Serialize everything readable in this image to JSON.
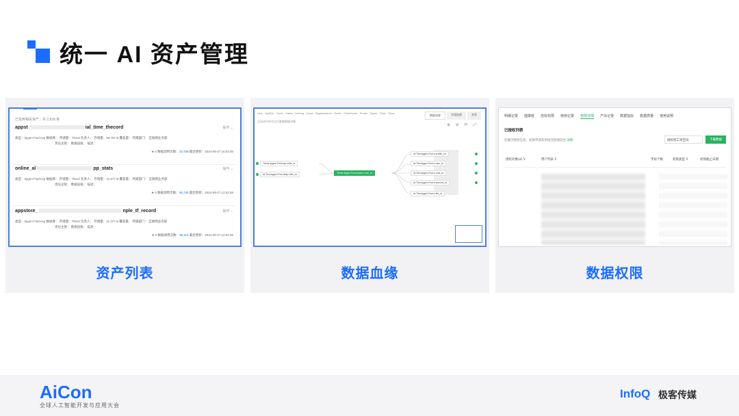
{
  "title": "统一 AI 资产管理",
  "cards": [
    {
      "caption": "资产列表"
    },
    {
      "caption": "数据血缘"
    },
    {
      "caption": "数据权限"
    }
  ],
  "asset_list": {
    "header": "已找到相关资产：共 2,818 条",
    "menu_label": "操作 ⌄",
    "items": [
      {
        "name_prefix": "appst",
        "name_suffix": "ial_time_thecord",
        "meta1": "类型：dygen-Fwd.exp   数据库：          存储量：Tlevel   负责人：             存储量：96.787 B   覆盖量：         所属部门：  互联网业务部",
        "meta2": "责任主管：       数据层级：       描述：",
        "right": "★ 0   数据调用次数：",
        "right_hl": "33,789",
        "right_tail": "   最近更新：2024-09-27 16:03:00"
      },
      {
        "name_prefix": "online_al",
        "name_suffix": "pp_stats",
        "meta1": "类型：dygen-Fwd.exp   数据库：          存储量：Tlevel   负责人：             存储量：21.077 B   覆盖量：         所属部门：  互联网业务部",
        "meta2": "责任主管：       数据层级：       描述：",
        "right": "★ 0   数据调用次数：",
        "right_hl": "36,730",
        "right_tail": "   最近更新：2024-09-27 12:01:56"
      },
      {
        "name_prefix": "appstore_",
        "name_suffix": "nple_tf_record",
        "meta1": "类型：dygen-Fwd.exp   数据库：          存储量：Tlevel   负责人：             存储量：11.377 B   覆盖量：         所属部门：  互联网业务部",
        "meta2": "责任主管：       数据层级：       描述：",
        "right": "★ 0   数据调用次数：",
        "right_hl": "39,113",
        "right_tail": "   最近更新：2024-09-27 12:51:56"
      }
    ]
  },
  "lineage": {
    "filters": "Hive  ·  MySQL  ·  Doris  ·  Kafka  ·  Iceberg  ·  Druid  ·  Elasticsearch  ·  Redis  ·  ClickHouse  ·  Presto  ·  Spark  ·  Flink  ·  Other",
    "tabs": [
      "数据血缘",
      "字段血缘",
      "关系"
    ],
    "subtitle": "点击选中的节点可查看数据详情",
    "tools": "⊕ ⊖ ⟳ ⤢",
    "nodes": [
      {
        "label": "Tlevel.dygen-Fwd.exp   mfile_id"
      },
      {
        "label": "dt-Tlev.dygen-Fwd.deep   nfile_id"
      },
      {
        "label": "Tlevel.dygen-Fwd.ename        core_id"
      },
      {
        "label": "dt-Tlev.dygen-Fwd.e   profile_ch"
      },
      {
        "label": "dt-Tlev.dygen-Fwd.e   user_id"
      },
      {
        "label": "dt-Tlev.dygen-Fwd.e   rank_id"
      },
      {
        "label": "dt-Tlev.dygen-Fwd.e   session_id"
      },
      {
        "label": "dt-Tlev.dygen-Fwd.e   file_id"
      }
    ]
  },
  "permissions": {
    "tabs": [
      "明细记录",
      "健康度",
      "自有权限",
      "使用记录",
      "权限详情",
      "产出记录",
      "数据指标",
      "数据质量",
      "使用说明"
    ],
    "active_tab": "权限详情",
    "section": "已授权列表",
    "note": "仅展示授权信息，权限申请及审批流程请前往",
    "note_link": "详情",
    "select_label": "授权到工单空间",
    "button_label": "下载数据",
    "columns": [
      "授权对象(id) ⊽",
      "用户列表 ⊽",
      "字段个数",
      "权限类型 ⊽",
      "权限截止日期"
    ]
  },
  "footer": {
    "aicon": "AiCon",
    "aicon_sub": "全球人工智能开发与应用大会",
    "infoq": "InfoQ",
    "infoq_cn": "极客传媒"
  },
  "colors": {
    "accent": "#1a6dff",
    "green": "#27b35f"
  }
}
